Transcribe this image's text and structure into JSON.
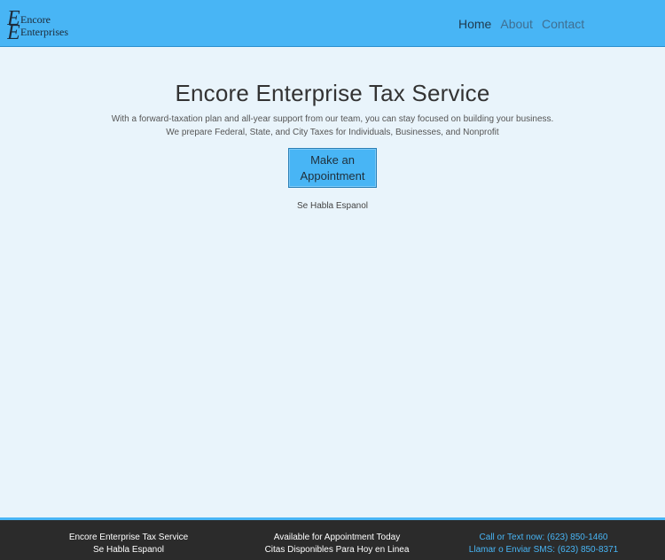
{
  "header": {
    "logo": {
      "line1": "Encore",
      "line2": "Enterprises",
      "icon": "encore-logo"
    },
    "nav": [
      {
        "label": "Home",
        "active": true
      },
      {
        "label": "About",
        "active": false
      },
      {
        "label": "Contact",
        "active": false
      }
    ]
  },
  "hero": {
    "title": "Encore Enterprise Tax Service",
    "tagline_line1": "With a forward-taxation plan and all-year support from our team, you can stay focused on building your business.",
    "tagline_line2": "We prepare Federal, State, and City Taxes for Individuals, Businesses, and Nonprofit",
    "cta_label": "Make an Appointment",
    "spanish_note": "Se Habla Espanol"
  },
  "footer": {
    "col1": {
      "line1": "Encore Enterprise Tax Service",
      "line2": "Se Habla Espanol"
    },
    "col2": {
      "line1": "Available for Appointment Today",
      "line2": "Citas Disponibles Para Hoy en Linea"
    },
    "col3": {
      "line1": "Call or Text now: (623) 850-1460",
      "line2": "Llamar o Enviar SMS: (623) 850-8371"
    }
  },
  "colors": {
    "accent": "#48b5f5",
    "background": "#e9f4fb",
    "footer_bg": "#2b2b2b"
  }
}
